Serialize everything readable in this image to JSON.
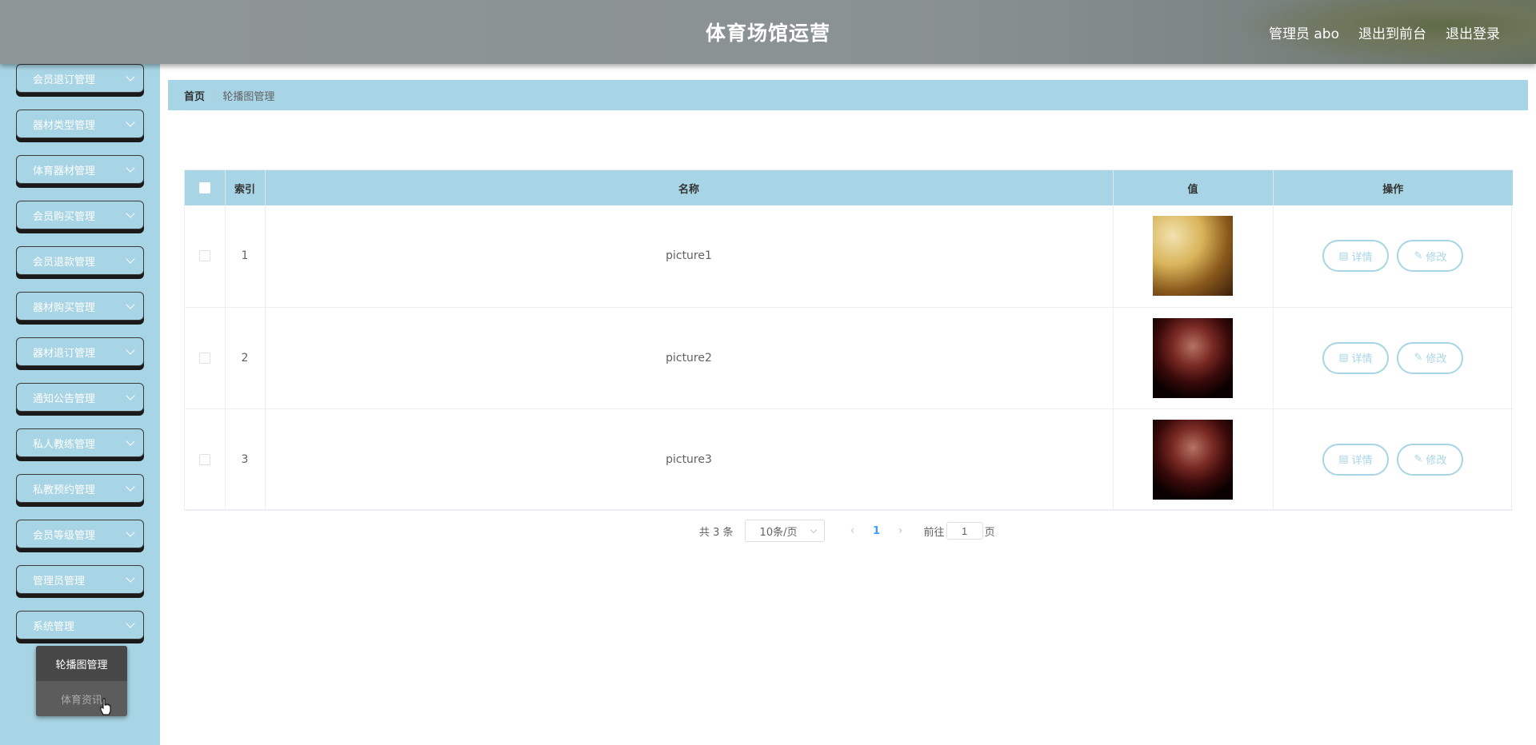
{
  "header": {
    "title": "体育场馆运营",
    "admin_label": "管理员 abo",
    "to_front_label": "退出到前台",
    "logout_label": "退出登录"
  },
  "sidebar": {
    "items": [
      {
        "label": "会员退订管理"
      },
      {
        "label": "器材类型管理"
      },
      {
        "label": "体育器材管理"
      },
      {
        "label": "会员购买管理"
      },
      {
        "label": "会员退款管理"
      },
      {
        "label": "器材购买管理"
      },
      {
        "label": "器材退订管理"
      },
      {
        "label": "通知公告管理"
      },
      {
        "label": "私人教练管理"
      },
      {
        "label": "私教预约管理"
      },
      {
        "label": "会员等级管理"
      },
      {
        "label": "管理员管理"
      },
      {
        "label": "系统管理"
      }
    ],
    "submenu": [
      {
        "label": "轮播图管理"
      },
      {
        "label": "体育资讯"
      }
    ]
  },
  "breadcrumb": {
    "home": "首页",
    "separator": "/",
    "current": "轮播图管理"
  },
  "table": {
    "headers": {
      "index": "索引",
      "name": "名称",
      "value": "值",
      "ops": "操作"
    },
    "rows": [
      {
        "index": "1",
        "name": "picture1",
        "detail_label": "详情",
        "edit_label": "修改"
      },
      {
        "index": "2",
        "name": "picture2",
        "detail_label": "详情",
        "edit_label": "修改"
      },
      {
        "index": "3",
        "name": "picture3",
        "detail_label": "详情",
        "edit_label": "修改"
      }
    ]
  },
  "pagination": {
    "total_label": "共 3 条",
    "page_size": "10条/页",
    "current_page": "1",
    "goto_prefix": "前往",
    "goto_value": "1",
    "goto_suffix": "页"
  },
  "colors": {
    "accent": "#a8d5e5",
    "header_bg": "#8f9698",
    "active_page": "#409eff"
  }
}
